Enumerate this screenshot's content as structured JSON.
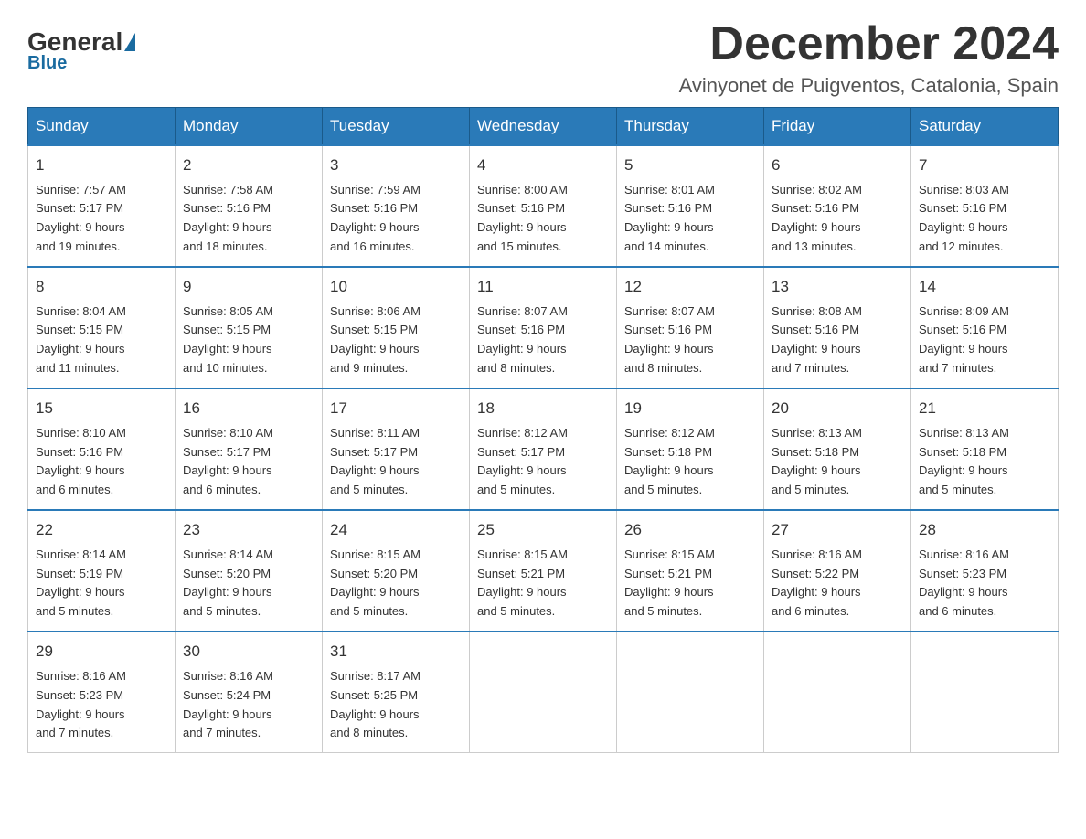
{
  "logo": {
    "general": "General",
    "blue": "Blue"
  },
  "header": {
    "month_year": "December 2024",
    "location": "Avinyonet de Puigventos, Catalonia, Spain"
  },
  "days_of_week": [
    "Sunday",
    "Monday",
    "Tuesday",
    "Wednesday",
    "Thursday",
    "Friday",
    "Saturday"
  ],
  "weeks": [
    [
      {
        "day": "1",
        "sunrise": "Sunrise: 7:57 AM",
        "sunset": "Sunset: 5:17 PM",
        "daylight": "Daylight: 9 hours",
        "daylight2": "and 19 minutes."
      },
      {
        "day": "2",
        "sunrise": "Sunrise: 7:58 AM",
        "sunset": "Sunset: 5:16 PM",
        "daylight": "Daylight: 9 hours",
        "daylight2": "and 18 minutes."
      },
      {
        "day": "3",
        "sunrise": "Sunrise: 7:59 AM",
        "sunset": "Sunset: 5:16 PM",
        "daylight": "Daylight: 9 hours",
        "daylight2": "and 16 minutes."
      },
      {
        "day": "4",
        "sunrise": "Sunrise: 8:00 AM",
        "sunset": "Sunset: 5:16 PM",
        "daylight": "Daylight: 9 hours",
        "daylight2": "and 15 minutes."
      },
      {
        "day": "5",
        "sunrise": "Sunrise: 8:01 AM",
        "sunset": "Sunset: 5:16 PM",
        "daylight": "Daylight: 9 hours",
        "daylight2": "and 14 minutes."
      },
      {
        "day": "6",
        "sunrise": "Sunrise: 8:02 AM",
        "sunset": "Sunset: 5:16 PM",
        "daylight": "Daylight: 9 hours",
        "daylight2": "and 13 minutes."
      },
      {
        "day": "7",
        "sunrise": "Sunrise: 8:03 AM",
        "sunset": "Sunset: 5:16 PM",
        "daylight": "Daylight: 9 hours",
        "daylight2": "and 12 minutes."
      }
    ],
    [
      {
        "day": "8",
        "sunrise": "Sunrise: 8:04 AM",
        "sunset": "Sunset: 5:15 PM",
        "daylight": "Daylight: 9 hours",
        "daylight2": "and 11 minutes."
      },
      {
        "day": "9",
        "sunrise": "Sunrise: 8:05 AM",
        "sunset": "Sunset: 5:15 PM",
        "daylight": "Daylight: 9 hours",
        "daylight2": "and 10 minutes."
      },
      {
        "day": "10",
        "sunrise": "Sunrise: 8:06 AM",
        "sunset": "Sunset: 5:15 PM",
        "daylight": "Daylight: 9 hours",
        "daylight2": "and 9 minutes."
      },
      {
        "day": "11",
        "sunrise": "Sunrise: 8:07 AM",
        "sunset": "Sunset: 5:16 PM",
        "daylight": "Daylight: 9 hours",
        "daylight2": "and 8 minutes."
      },
      {
        "day": "12",
        "sunrise": "Sunrise: 8:07 AM",
        "sunset": "Sunset: 5:16 PM",
        "daylight": "Daylight: 9 hours",
        "daylight2": "and 8 minutes."
      },
      {
        "day": "13",
        "sunrise": "Sunrise: 8:08 AM",
        "sunset": "Sunset: 5:16 PM",
        "daylight": "Daylight: 9 hours",
        "daylight2": "and 7 minutes."
      },
      {
        "day": "14",
        "sunrise": "Sunrise: 8:09 AM",
        "sunset": "Sunset: 5:16 PM",
        "daylight": "Daylight: 9 hours",
        "daylight2": "and 7 minutes."
      }
    ],
    [
      {
        "day": "15",
        "sunrise": "Sunrise: 8:10 AM",
        "sunset": "Sunset: 5:16 PM",
        "daylight": "Daylight: 9 hours",
        "daylight2": "and 6 minutes."
      },
      {
        "day": "16",
        "sunrise": "Sunrise: 8:10 AM",
        "sunset": "Sunset: 5:17 PM",
        "daylight": "Daylight: 9 hours",
        "daylight2": "and 6 minutes."
      },
      {
        "day": "17",
        "sunrise": "Sunrise: 8:11 AM",
        "sunset": "Sunset: 5:17 PM",
        "daylight": "Daylight: 9 hours",
        "daylight2": "and 5 minutes."
      },
      {
        "day": "18",
        "sunrise": "Sunrise: 8:12 AM",
        "sunset": "Sunset: 5:17 PM",
        "daylight": "Daylight: 9 hours",
        "daylight2": "and 5 minutes."
      },
      {
        "day": "19",
        "sunrise": "Sunrise: 8:12 AM",
        "sunset": "Sunset: 5:18 PM",
        "daylight": "Daylight: 9 hours",
        "daylight2": "and 5 minutes."
      },
      {
        "day": "20",
        "sunrise": "Sunrise: 8:13 AM",
        "sunset": "Sunset: 5:18 PM",
        "daylight": "Daylight: 9 hours",
        "daylight2": "and 5 minutes."
      },
      {
        "day": "21",
        "sunrise": "Sunrise: 8:13 AM",
        "sunset": "Sunset: 5:18 PM",
        "daylight": "Daylight: 9 hours",
        "daylight2": "and 5 minutes."
      }
    ],
    [
      {
        "day": "22",
        "sunrise": "Sunrise: 8:14 AM",
        "sunset": "Sunset: 5:19 PM",
        "daylight": "Daylight: 9 hours",
        "daylight2": "and 5 minutes."
      },
      {
        "day": "23",
        "sunrise": "Sunrise: 8:14 AM",
        "sunset": "Sunset: 5:20 PM",
        "daylight": "Daylight: 9 hours",
        "daylight2": "and 5 minutes."
      },
      {
        "day": "24",
        "sunrise": "Sunrise: 8:15 AM",
        "sunset": "Sunset: 5:20 PM",
        "daylight": "Daylight: 9 hours",
        "daylight2": "and 5 minutes."
      },
      {
        "day": "25",
        "sunrise": "Sunrise: 8:15 AM",
        "sunset": "Sunset: 5:21 PM",
        "daylight": "Daylight: 9 hours",
        "daylight2": "and 5 minutes."
      },
      {
        "day": "26",
        "sunrise": "Sunrise: 8:15 AM",
        "sunset": "Sunset: 5:21 PM",
        "daylight": "Daylight: 9 hours",
        "daylight2": "and 5 minutes."
      },
      {
        "day": "27",
        "sunrise": "Sunrise: 8:16 AM",
        "sunset": "Sunset: 5:22 PM",
        "daylight": "Daylight: 9 hours",
        "daylight2": "and 6 minutes."
      },
      {
        "day": "28",
        "sunrise": "Sunrise: 8:16 AM",
        "sunset": "Sunset: 5:23 PM",
        "daylight": "Daylight: 9 hours",
        "daylight2": "and 6 minutes."
      }
    ],
    [
      {
        "day": "29",
        "sunrise": "Sunrise: 8:16 AM",
        "sunset": "Sunset: 5:23 PM",
        "daylight": "Daylight: 9 hours",
        "daylight2": "and 7 minutes."
      },
      {
        "day": "30",
        "sunrise": "Sunrise: 8:16 AM",
        "sunset": "Sunset: 5:24 PM",
        "daylight": "Daylight: 9 hours",
        "daylight2": "and 7 minutes."
      },
      {
        "day": "31",
        "sunrise": "Sunrise: 8:17 AM",
        "sunset": "Sunset: 5:25 PM",
        "daylight": "Daylight: 9 hours",
        "daylight2": "and 8 minutes."
      },
      null,
      null,
      null,
      null
    ]
  ]
}
